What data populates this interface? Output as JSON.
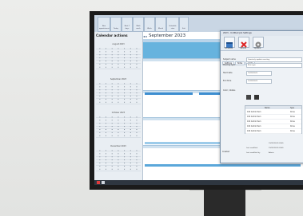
{
  "sidebar": {
    "title": "Calendar actions",
    "calendars": [
      {
        "month": "August 2023"
      },
      {
        "month": "September 2023"
      },
      {
        "month": "October 2023"
      },
      {
        "month": "December 2023"
      }
    ]
  },
  "calendar": {
    "month_title": "September 2023",
    "nav_arrows": "◂ ▸"
  },
  "ribbon": {
    "buttons": [
      "New appointment",
      "Today",
      "Next 7 days",
      "Work week",
      "Week",
      "Month",
      "Schedule view",
      "Exit"
    ]
  },
  "dialog": {
    "title": "2023 - Untitled Job Settings",
    "toolbar": [
      "Schedule",
      "Cancel",
      "Options"
    ],
    "tabs": [
      "Settings",
      "Notes",
      "Costs"
    ],
    "fields": [
      {
        "label": "Subject name",
        "value": "Quarterly update meeting"
      },
      {
        "label": "Meeting type",
        "value": "New type"
      },
      {
        "label": "Start date",
        "value": "19/09/2023"
      },
      {
        "label": "End time",
        "value": "21/09/2023"
      },
      {
        "label": "Color / status",
        "value": ""
      }
    ],
    "table": {
      "headers": [
        "Name",
        "Type"
      ],
      "rows": [
        {
          "name": "100 Admin Item",
          "type": "Done"
        },
        {
          "name": "100 Admin Item",
          "type": "Done"
        },
        {
          "name": "100 Admin Item",
          "type": "Done"
        },
        {
          "name": "100 Admin Item",
          "type": "Done"
        },
        {
          "name": "100 Admin Item",
          "type": "Done"
        }
      ]
    },
    "footer": [
      {
        "label": "Created",
        "value": "19/09/2023 09:45"
      },
      {
        "label": "Last modified",
        "value": "19/09/2023 09:45"
      },
      {
        "label": "Last modified by",
        "value": "Admin"
      }
    ]
  },
  "colors": {
    "accent": "#3d8ed0",
    "selection": "#67b3de",
    "statusbar": "#2e3640"
  }
}
